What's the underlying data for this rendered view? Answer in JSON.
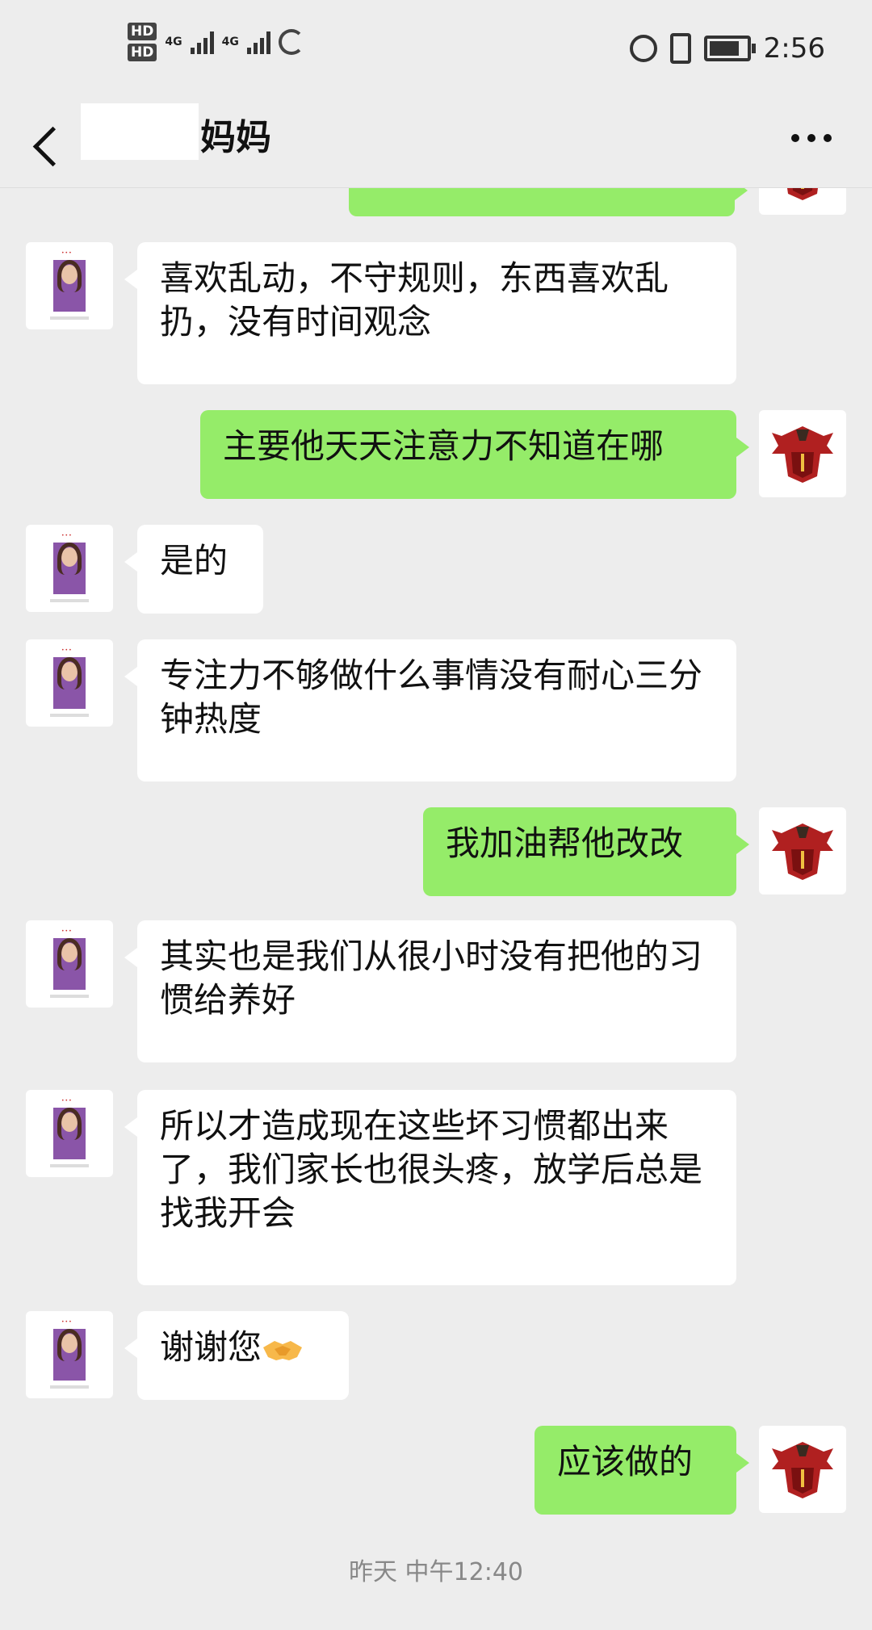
{
  "status_bar": {
    "hd1": "HD",
    "hd2": "HD",
    "net1": "4G",
    "net2": "4G",
    "time": "2:56"
  },
  "header": {
    "title": "妈妈",
    "back_icon": "chevron-left-icon",
    "more_icon": "more-horizontal-icon"
  },
  "messages": [
    {
      "side": "right",
      "text": "",
      "partial": true
    },
    {
      "side": "left",
      "text": "喜欢乱动，不守规则，东西喜欢乱扔，没有时间观念"
    },
    {
      "side": "right",
      "text": "主要他天天注意力不知道在哪"
    },
    {
      "side": "left",
      "text": "是的"
    },
    {
      "side": "left",
      "text": "专注力不够做什么事情没有耐心三分钟热度"
    },
    {
      "side": "right",
      "text": "我加油帮他改改"
    },
    {
      "side": "left",
      "text": "其实也是我们从很小时没有把他的习惯给养好"
    },
    {
      "side": "left",
      "text": "所以才造成现在这些坏习惯都出来了，我们家长也很头疼，放学后总是找我开会"
    },
    {
      "side": "left",
      "text": "谢谢您",
      "emoji": "handshake-emoji"
    },
    {
      "side": "right",
      "text": "应该做的"
    }
  ],
  "timestamp": "昨天 中午12:40",
  "colors": {
    "background": "#ededed",
    "bubble_self": "#95ec69",
    "bubble_other": "#ffffff"
  }
}
